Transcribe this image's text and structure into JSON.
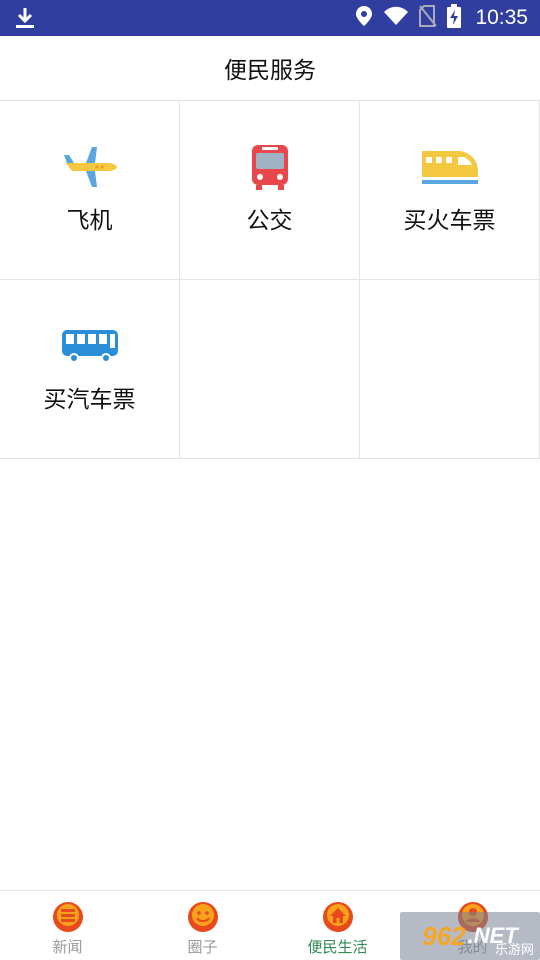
{
  "status_bar": {
    "time": "10:35",
    "icons": [
      "download-icon",
      "location-icon",
      "wifi-icon",
      "no-sim-icon",
      "battery-charging-icon"
    ]
  },
  "header": {
    "title": "便民服务"
  },
  "services": [
    {
      "label": "飞机",
      "icon": "airplane-icon",
      "color": "#f5c842"
    },
    {
      "label": "公交",
      "icon": "city-bus-icon",
      "color": "#e8474c"
    },
    {
      "label": "买火车票",
      "icon": "train-icon",
      "color": "#f5c842"
    },
    {
      "label": "买汽车票",
      "icon": "coach-bus-icon",
      "color": "#2a8fd8"
    }
  ],
  "bottom_nav": {
    "items": [
      {
        "label": "新闻",
        "icon": "news-icon",
        "active": false
      },
      {
        "label": "圈子",
        "icon": "smiley-icon",
        "active": false
      },
      {
        "label": "便民生活",
        "icon": "home-icon",
        "active": true
      },
      {
        "label": "我的",
        "icon": "profile-icon",
        "active": false
      }
    ],
    "active_color": "#2e8b57",
    "inactive_color": "#9a9a9a"
  },
  "watermark": {
    "brand": "962",
    "suffix": ".NET",
    "sub": "乐游网"
  }
}
